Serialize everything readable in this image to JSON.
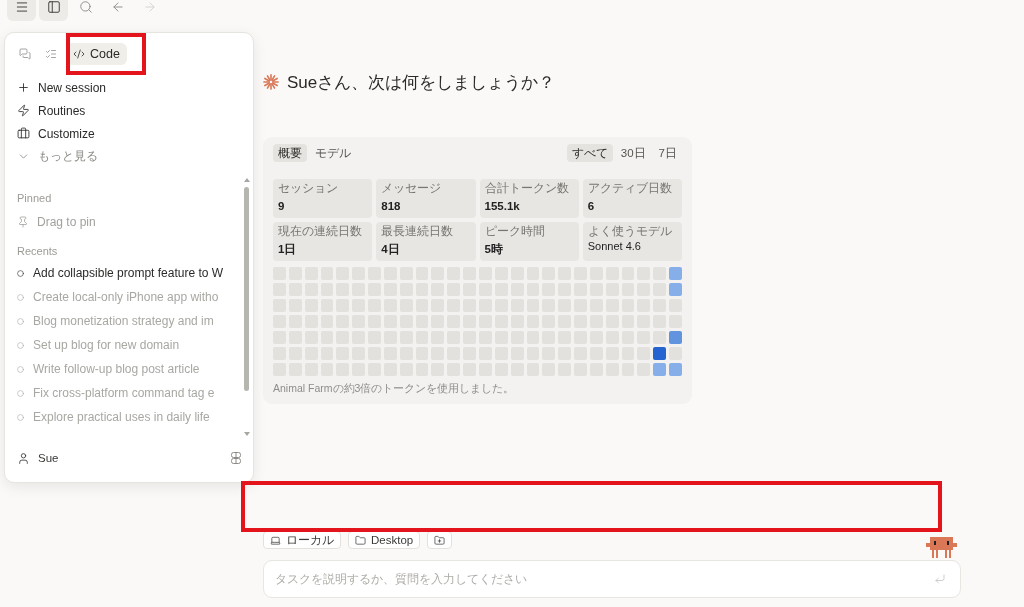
{
  "toolbar": [
    {
      "kind": "menu",
      "pressed": true,
      "disabled": false
    },
    {
      "kind": "sidebar",
      "pressed": true,
      "disabled": false
    },
    {
      "kind": "search",
      "pressed": false,
      "disabled": false
    },
    {
      "kind": "back",
      "pressed": false,
      "disabled": false
    },
    {
      "kind": "forward",
      "pressed": false,
      "disabled": true
    }
  ],
  "menu_panel": {
    "mode_tabs": [
      {
        "kind": "chat",
        "selected": false
      },
      {
        "kind": "tasks",
        "selected": false
      },
      {
        "kind": "code",
        "label": "Code",
        "selected": true
      }
    ],
    "actions": [
      {
        "kind": "new",
        "label": "New session"
      },
      {
        "kind": "routines",
        "label": "Routines"
      },
      {
        "kind": "customize",
        "label": "Customize"
      },
      {
        "kind": "more",
        "label": "もっと見る"
      }
    ],
    "pinned": {
      "title": "Pinned",
      "hint": "Drag to pin"
    },
    "recents": {
      "title": "Recents",
      "items": [
        {
          "title": "Add collapsible prompt feature to W",
          "dimmed": false
        },
        {
          "title": "Create local-only iPhone app witho",
          "dimmed": true
        },
        {
          "title": "Blog monetization strategy and im",
          "dimmed": true
        },
        {
          "title": "Set up blog for new domain",
          "dimmed": true
        },
        {
          "title": "Write follow-up blog post article",
          "dimmed": true
        },
        {
          "title": "Fix cross-platform command tag e",
          "dimmed": true
        },
        {
          "title": "Explore practical uses in daily life",
          "dimmed": true
        }
      ]
    },
    "user": {
      "name": "Sue"
    }
  },
  "greeting": "Sueさん、次は何をしましょうか？",
  "stats_card": {
    "view_tabs": [
      {
        "label": "概要",
        "selected": true
      },
      {
        "label": "モデル",
        "selected": false
      }
    ],
    "range_tabs": [
      {
        "label": "すべて",
        "selected": true
      },
      {
        "label": "30日",
        "selected": false
      },
      {
        "label": "7日",
        "selected": false
      }
    ],
    "stats": [
      {
        "kind": "number",
        "label": "セッション",
        "value": "9"
      },
      {
        "kind": "number",
        "label": "メッセージ",
        "value": "818"
      },
      {
        "kind": "number",
        "label": "合計トークン数",
        "value": "155.1k"
      },
      {
        "kind": "number",
        "label": "アクティブ日数",
        "value": "6"
      },
      {
        "kind": "number",
        "label": "現在の連続日数",
        "value": "1日"
      },
      {
        "kind": "number",
        "label": "最長連続日数",
        "value": "4日"
      },
      {
        "kind": "number",
        "label": "ピーク時間",
        "value": "5時"
      },
      {
        "kind": "name",
        "label": "よく使うモデル",
        "value": "Sonnet 4.6"
      }
    ],
    "activity": {
      "weeks": [
        {
          "days": [
            {
              "color": "#e2e1de"
            },
            {
              "color": "#e2e1de"
            },
            {
              "color": "#e2e1de"
            },
            {
              "color": "#e2e1de"
            },
            {
              "color": "#e2e1de"
            },
            {
              "color": "#e2e1de"
            },
            {
              "color": "#e2e1de"
            }
          ]
        },
        {
          "days": [
            {
              "color": "#e2e1de"
            },
            {
              "color": "#e2e1de"
            },
            {
              "color": "#e2e1de"
            },
            {
              "color": "#e2e1de"
            },
            {
              "color": "#e2e1de"
            },
            {
              "color": "#e2e1de"
            },
            {
              "color": "#e2e1de"
            }
          ]
        },
        {
          "days": [
            {
              "color": "#e2e1de"
            },
            {
              "color": "#e2e1de"
            },
            {
              "color": "#e2e1de"
            },
            {
              "color": "#e2e1de"
            },
            {
              "color": "#e2e1de"
            },
            {
              "color": "#e2e1de"
            },
            {
              "color": "#e2e1de"
            }
          ]
        },
        {
          "days": [
            {
              "color": "#e2e1de"
            },
            {
              "color": "#e2e1de"
            },
            {
              "color": "#e2e1de"
            },
            {
              "color": "#e2e1de"
            },
            {
              "color": "#e2e1de"
            },
            {
              "color": "#e2e1de"
            },
            {
              "color": "#e2e1de"
            }
          ]
        },
        {
          "days": [
            {
              "color": "#e2e1de"
            },
            {
              "color": "#e2e1de"
            },
            {
              "color": "#e2e1de"
            },
            {
              "color": "#e2e1de"
            },
            {
              "color": "#e2e1de"
            },
            {
              "color": "#e2e1de"
            },
            {
              "color": "#e2e1de"
            }
          ]
        },
        {
          "days": [
            {
              "color": "#e2e1de"
            },
            {
              "color": "#e2e1de"
            },
            {
              "color": "#e2e1de"
            },
            {
              "color": "#e2e1de"
            },
            {
              "color": "#e2e1de"
            },
            {
              "color": "#e2e1de"
            },
            {
              "color": "#e2e1de"
            }
          ]
        },
        {
          "days": [
            {
              "color": "#e2e1de"
            },
            {
              "color": "#e2e1de"
            },
            {
              "color": "#e2e1de"
            },
            {
              "color": "#e2e1de"
            },
            {
              "color": "#e2e1de"
            },
            {
              "color": "#e2e1de"
            },
            {
              "color": "#e2e1de"
            }
          ]
        },
        {
          "days": [
            {
              "color": "#e2e1de"
            },
            {
              "color": "#e2e1de"
            },
            {
              "color": "#e2e1de"
            },
            {
              "color": "#e2e1de"
            },
            {
              "color": "#e2e1de"
            },
            {
              "color": "#e2e1de"
            },
            {
              "color": "#e2e1de"
            }
          ]
        },
        {
          "days": [
            {
              "color": "#e2e1de"
            },
            {
              "color": "#e2e1de"
            },
            {
              "color": "#e2e1de"
            },
            {
              "color": "#e2e1de"
            },
            {
              "color": "#e2e1de"
            },
            {
              "color": "#e2e1de"
            },
            {
              "color": "#e2e1de"
            }
          ]
        },
        {
          "days": [
            {
              "color": "#e2e1de"
            },
            {
              "color": "#e2e1de"
            },
            {
              "color": "#e2e1de"
            },
            {
              "color": "#e2e1de"
            },
            {
              "color": "#e2e1de"
            },
            {
              "color": "#e2e1de"
            },
            {
              "color": "#e2e1de"
            }
          ]
        },
        {
          "days": [
            {
              "color": "#e2e1de"
            },
            {
              "color": "#e2e1de"
            },
            {
              "color": "#e2e1de"
            },
            {
              "color": "#e2e1de"
            },
            {
              "color": "#e2e1de"
            },
            {
              "color": "#e2e1de"
            },
            {
              "color": "#e2e1de"
            }
          ]
        },
        {
          "days": [
            {
              "color": "#e2e1de"
            },
            {
              "color": "#e2e1de"
            },
            {
              "color": "#e2e1de"
            },
            {
              "color": "#e2e1de"
            },
            {
              "color": "#e2e1de"
            },
            {
              "color": "#e2e1de"
            },
            {
              "color": "#e2e1de"
            }
          ]
        },
        {
          "days": [
            {
              "color": "#e2e1de"
            },
            {
              "color": "#e2e1de"
            },
            {
              "color": "#e2e1de"
            },
            {
              "color": "#e2e1de"
            },
            {
              "color": "#e2e1de"
            },
            {
              "color": "#e2e1de"
            },
            {
              "color": "#e2e1de"
            }
          ]
        },
        {
          "days": [
            {
              "color": "#e2e1de"
            },
            {
              "color": "#e2e1de"
            },
            {
              "color": "#e2e1de"
            },
            {
              "color": "#e2e1de"
            },
            {
              "color": "#e2e1de"
            },
            {
              "color": "#e2e1de"
            },
            {
              "color": "#e2e1de"
            }
          ]
        },
        {
          "days": [
            {
              "color": "#e2e1de"
            },
            {
              "color": "#e2e1de"
            },
            {
              "color": "#e2e1de"
            },
            {
              "color": "#e2e1de"
            },
            {
              "color": "#e2e1de"
            },
            {
              "color": "#e2e1de"
            },
            {
              "color": "#e2e1de"
            }
          ]
        },
        {
          "days": [
            {
              "color": "#e2e1de"
            },
            {
              "color": "#e2e1de"
            },
            {
              "color": "#e2e1de"
            },
            {
              "color": "#e2e1de"
            },
            {
              "color": "#e2e1de"
            },
            {
              "color": "#e2e1de"
            },
            {
              "color": "#e2e1de"
            }
          ]
        },
        {
          "days": [
            {
              "color": "#e2e1de"
            },
            {
              "color": "#e2e1de"
            },
            {
              "color": "#e2e1de"
            },
            {
              "color": "#e2e1de"
            },
            {
              "color": "#e2e1de"
            },
            {
              "color": "#e2e1de"
            },
            {
              "color": "#e2e1de"
            }
          ]
        },
        {
          "days": [
            {
              "color": "#e2e1de"
            },
            {
              "color": "#e2e1de"
            },
            {
              "color": "#e2e1de"
            },
            {
              "color": "#e2e1de"
            },
            {
              "color": "#e2e1de"
            },
            {
              "color": "#e2e1de"
            },
            {
              "color": "#e2e1de"
            }
          ]
        },
        {
          "days": [
            {
              "color": "#e2e1de"
            },
            {
              "color": "#e2e1de"
            },
            {
              "color": "#e2e1de"
            },
            {
              "color": "#e2e1de"
            },
            {
              "color": "#e2e1de"
            },
            {
              "color": "#e2e1de"
            },
            {
              "color": "#e2e1de"
            }
          ]
        },
        {
          "days": [
            {
              "color": "#e2e1de"
            },
            {
              "color": "#e2e1de"
            },
            {
              "color": "#e2e1de"
            },
            {
              "color": "#e2e1de"
            },
            {
              "color": "#e2e1de"
            },
            {
              "color": "#e2e1de"
            },
            {
              "color": "#e2e1de"
            }
          ]
        },
        {
          "days": [
            {
              "color": "#e2e1de"
            },
            {
              "color": "#e2e1de"
            },
            {
              "color": "#e2e1de"
            },
            {
              "color": "#e2e1de"
            },
            {
              "color": "#e2e1de"
            },
            {
              "color": "#e2e1de"
            },
            {
              "color": "#e2e1de"
            }
          ]
        },
        {
          "days": [
            {
              "color": "#e2e1de"
            },
            {
              "color": "#e2e1de"
            },
            {
              "color": "#e2e1de"
            },
            {
              "color": "#e2e1de"
            },
            {
              "color": "#e2e1de"
            },
            {
              "color": "#e2e1de"
            },
            {
              "color": "#e2e1de"
            }
          ]
        },
        {
          "days": [
            {
              "color": "#e2e1de"
            },
            {
              "color": "#e2e1de"
            },
            {
              "color": "#e2e1de"
            },
            {
              "color": "#e2e1de"
            },
            {
              "color": "#e2e1de"
            },
            {
              "color": "#e2e1de"
            },
            {
              "color": "#e2e1de"
            }
          ]
        },
        {
          "days": [
            {
              "color": "#e2e1de"
            },
            {
              "color": "#e2e1de"
            },
            {
              "color": "#e2e1de"
            },
            {
              "color": "#e2e1de"
            },
            {
              "color": "#e2e1de"
            },
            {
              "color": "#e2e1de"
            },
            {
              "color": "#e2e1de"
            }
          ]
        },
        {
          "days": [
            {
              "color": "#e2e1de"
            },
            {
              "color": "#e2e1de"
            },
            {
              "color": "#e2e1de"
            },
            {
              "color": "#e2e1de"
            },
            {
              "color": "#e2e1de"
            },
            {
              "color": "#2563d0"
            },
            {
              "color": "#86aee8"
            }
          ]
        },
        {
          "days": [
            {
              "color": "#86aee8"
            },
            {
              "color": "#86aee8"
            },
            {
              "color": "#e2e1de"
            },
            {
              "color": "#e2e1de"
            },
            {
              "color": "#6193df"
            },
            {
              "color": "#e2e1de"
            },
            {
              "color": "#86aee8"
            }
          ]
        }
      ]
    },
    "note": "Animal Farmの約3倍のトークンを使用しました。"
  },
  "composer": {
    "chips": [
      {
        "kind": "local",
        "label": "ローカル"
      },
      {
        "kind": "folder",
        "label": "Desktop"
      },
      {
        "kind": "add-folder"
      }
    ],
    "input": {
      "placeholder": "タスクを説明するか、質問を入力してください"
    }
  }
}
